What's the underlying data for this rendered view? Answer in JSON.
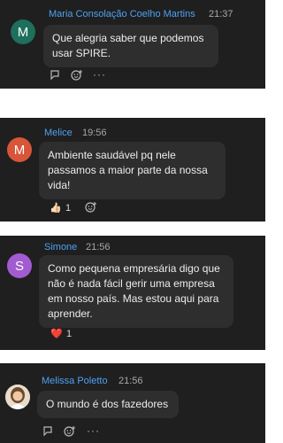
{
  "messages": [
    {
      "initial": "M",
      "avatar_color": "#1e6f5c",
      "name": "Maria Consolação Coelho Martins",
      "time": "21:37",
      "text": "Que alegria saber que podemos\nusar SPIRE.",
      "actions": [
        "reply-icon",
        "add-reaction-icon",
        "more-icon"
      ]
    },
    {
      "initial": "M",
      "avatar_color": "#d9553a",
      "name": "Melice",
      "time": "19:56",
      "text": "Ambiente saudável pq nele\npassamos a maior parte da nossa\nvida!",
      "reaction": {
        "icon": "thumbs-up-icon",
        "glyph": "👍🏻",
        "count": "1"
      },
      "actions": [
        "add-reaction-icon"
      ]
    },
    {
      "initial": "S",
      "avatar_color": "#a25bd0",
      "name": "Simone",
      "time": "21:56",
      "text": "Como pequena empresária digo que\nnão é nada fácil gerir uma empresa\nem nosso país. Mas estou aqui para\naprender.",
      "reaction": {
        "icon": "heart-icon",
        "glyph": "❤️",
        "count": "1"
      }
    },
    {
      "initial": "",
      "avatar_color": "#c9a27a",
      "name": "Melissa Poletto",
      "time": "21:56",
      "text": "O mundo é dos fazedores",
      "actions": [
        "reply-icon",
        "add-reaction-icon",
        "more-icon"
      ]
    }
  ]
}
